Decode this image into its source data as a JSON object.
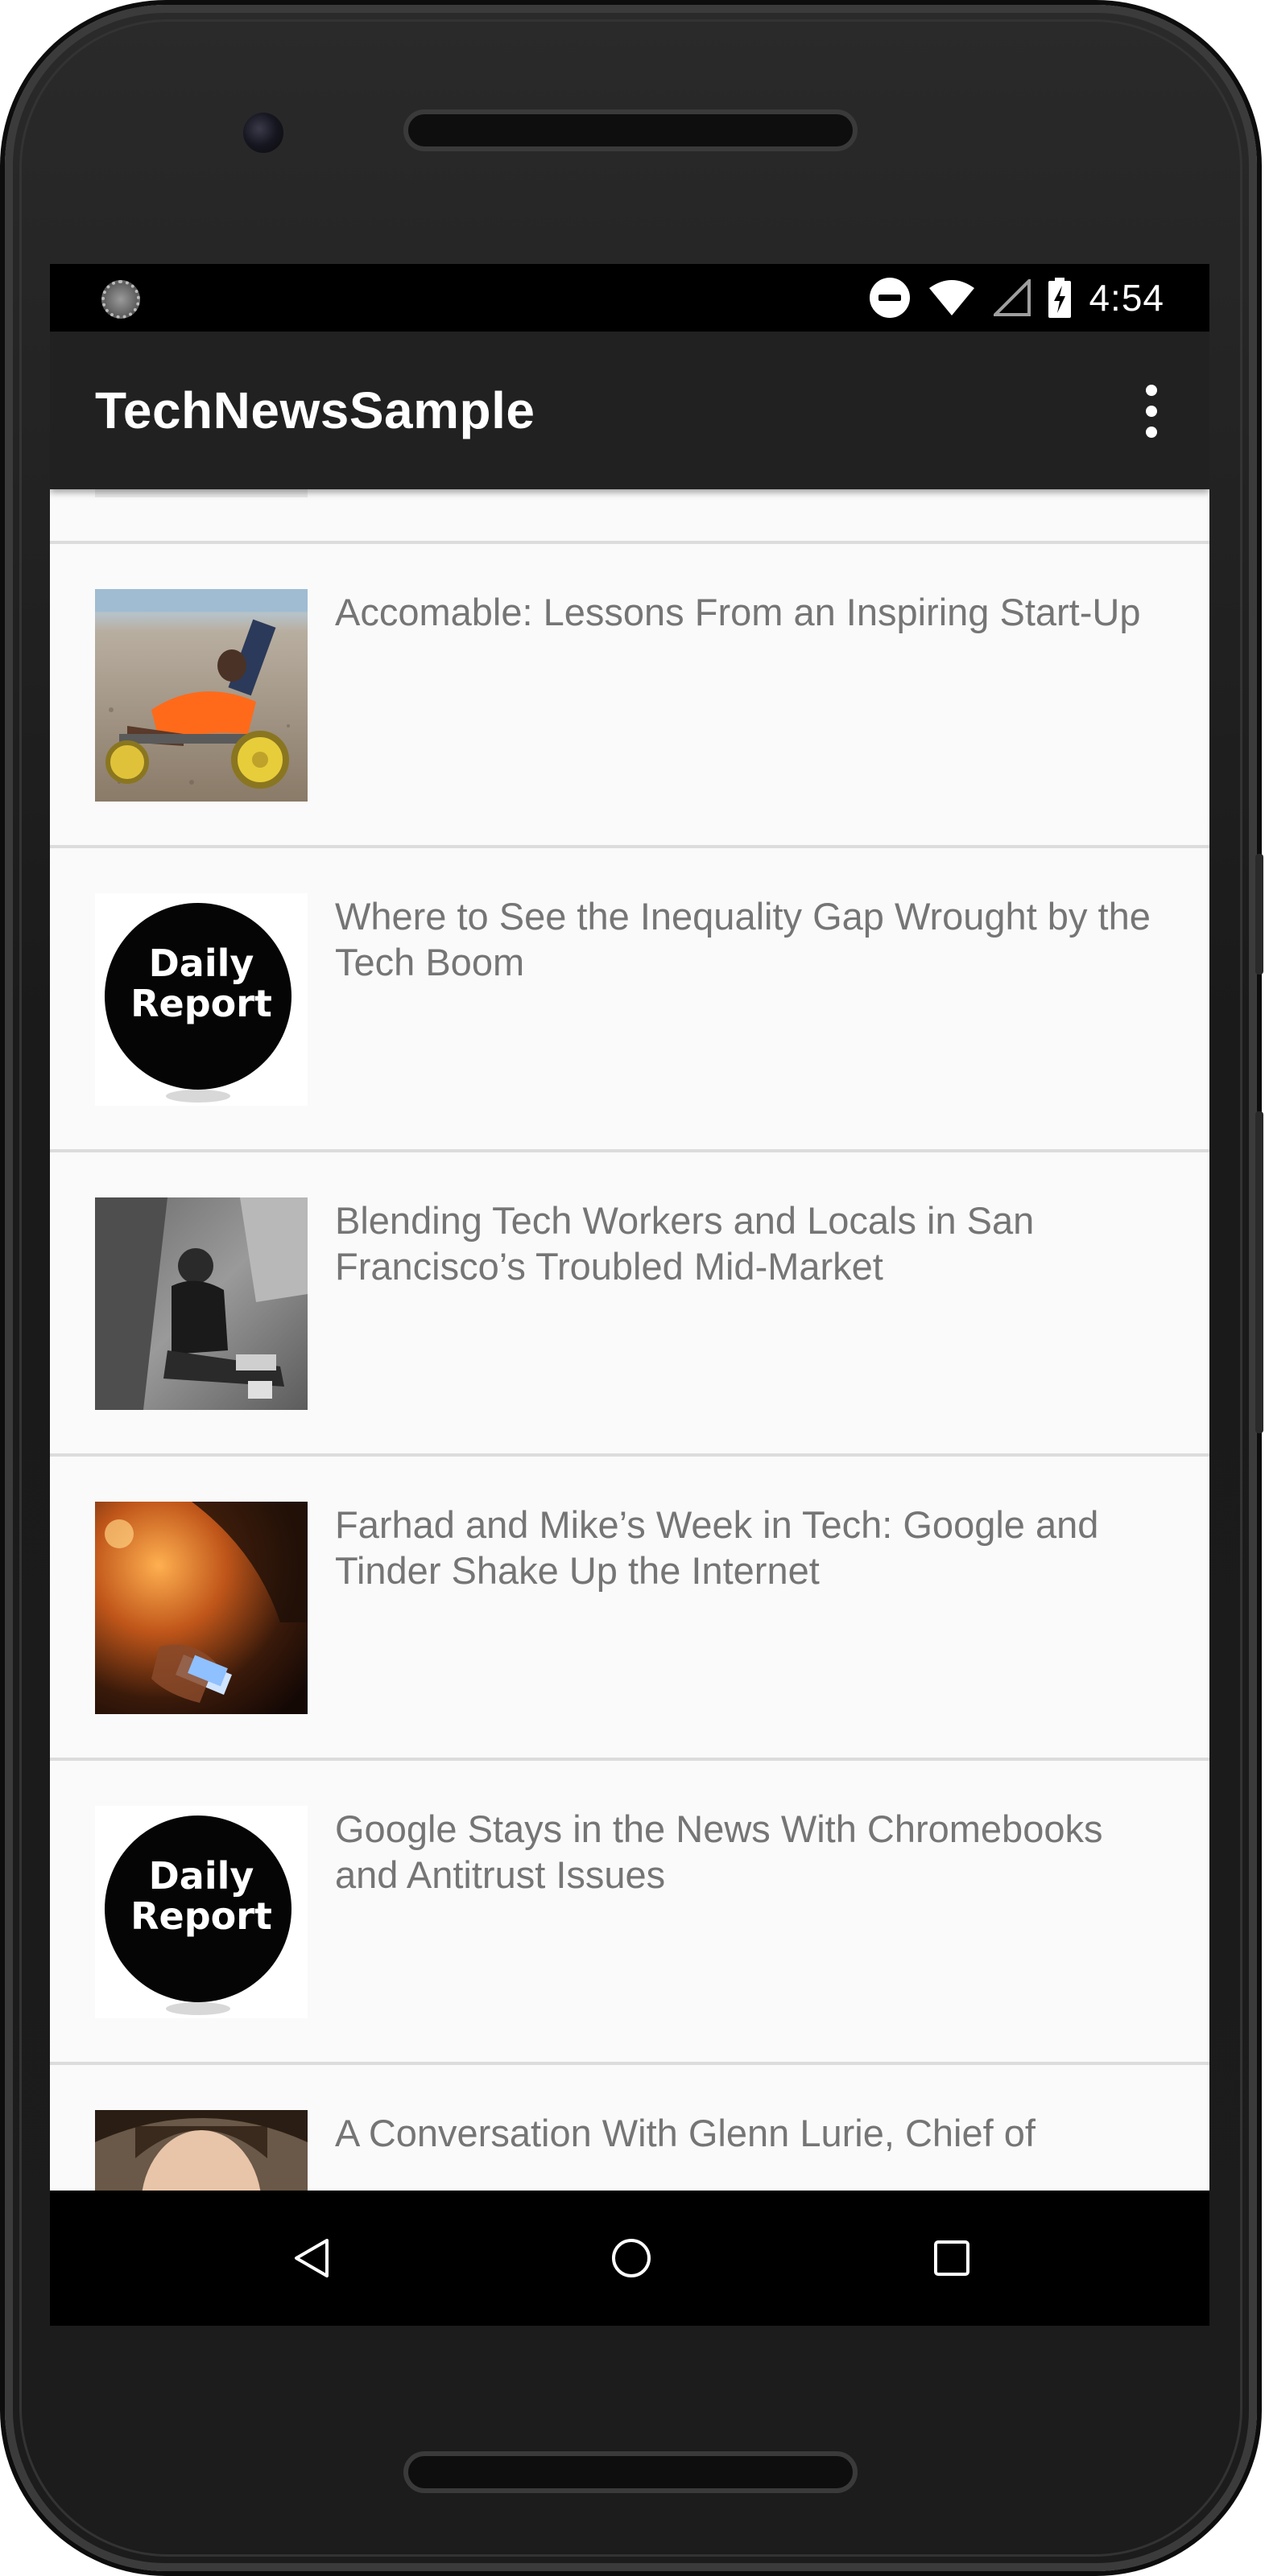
{
  "status_bar": {
    "time": "4:54",
    "icons": [
      "sync-icon",
      "do-not-disturb-icon",
      "wifi-icon",
      "cell-signal-icon",
      "battery-charging-icon"
    ]
  },
  "app_bar": {
    "title": "TechNewsSample",
    "menu_icon": "overflow-menu-icon"
  },
  "articles": [
    {
      "title": "",
      "thumbnail": "faded-image"
    },
    {
      "title": "Accomable: Lessons From an Inspiring Start-Up",
      "thumbnail": "beach-wheelchair-photo"
    },
    {
      "title": "Where to See the Inequality Gap Wrought by the Tech Boom",
      "thumbnail": "daily-report-logo"
    },
    {
      "title": "Blending Tech Workers and Locals in San Francisco’s Troubled Mid-Market",
      "thumbnail": "bw-man-sitting-photo"
    },
    {
      "title": "Farhad and Mike’s Week in Tech: Google and Tinder Shake Up the Internet",
      "thumbnail": "phone-in-hand-photo"
    },
    {
      "title": "Google Stays in the News With Chromebooks and Antitrust Issues",
      "thumbnail": "daily-report-logo"
    },
    {
      "title": "A Conversation With Glenn Lurie, Chief of",
      "thumbnail": "portrait-photo"
    }
  ],
  "daily_report_logo": {
    "line1": "Daily",
    "line2": "Report"
  },
  "nav_bar": {
    "buttons": [
      "back-icon",
      "home-icon",
      "recents-icon"
    ]
  },
  "colors": {
    "app_bar": "#212121",
    "list_bg": "#fafafa",
    "title_text": "#757575",
    "divider": "#dcdcdc"
  }
}
